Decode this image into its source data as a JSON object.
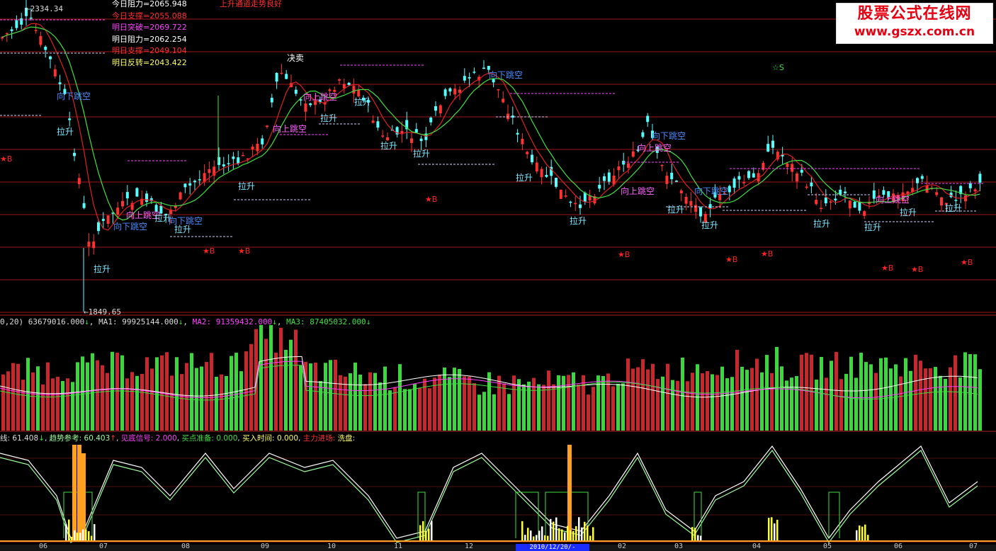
{
  "header": {
    "high_marker": "2334.34",
    "low_marker": "1849.65",
    "status_text": "上升通道走势良好",
    "levels": [
      {
        "label": "今日阻力=",
        "value": "2065.948",
        "color": "#ffffff"
      },
      {
        "label": "今日支撑=",
        "value": "2055.088",
        "color": "#ff3030"
      },
      {
        "label": "明日突破=",
        "value": "2069.722",
        "color": "#ff40ff"
      },
      {
        "label": "明日阻力=",
        "value": "2062.254",
        "color": "#ffffff"
      },
      {
        "label": "明日支撑=",
        "value": "2049.104",
        "color": "#ff3030"
      },
      {
        "label": "明日反转=",
        "value": "2043.422",
        "color": "#ffff60"
      }
    ]
  },
  "logo": {
    "line1": "股票公式在线网",
    "line2": "www.gszx.com.cn"
  },
  "signals": {
    "gap_down": "向下跳空",
    "gap_up": "向上跳空",
    "pull_up": "拉升",
    "buy_sell": "决卖",
    "star_b": "★B",
    "star_s": "☆S"
  },
  "volume_panel": {
    "prefix": "0,20)",
    "vol": "63679016.000",
    "ma1_label": "MA1:",
    "ma1": "99925144.000",
    "ma2_label": "MA2:",
    "ma2": "91359432.000",
    "ma3_label": "MA3:",
    "ma3": "87405032.000",
    "arrow": "↓"
  },
  "indicator_panel": {
    "line_label": "线:",
    "line_value": "61.408",
    "trend_label": "趋势参考:",
    "trend_value": "60.403",
    "up_arrow": "↑",
    "down_arrow": "↓",
    "bottom_label": "见底信号:",
    "bottom_value": "2.000",
    "prep_label": "买点准备:",
    "prep_value": "0.000",
    "buytime_label": "买入时间:",
    "buytime_value": "0.000",
    "main_label": "主力进场:",
    "wash_label": "洗盘:"
  },
  "time_axis": {
    "labels": [
      "06",
      "07",
      "08",
      "09",
      "10",
      "11",
      "12",
      "02",
      "03",
      "04",
      "05",
      "06",
      "07"
    ],
    "selected_date": "2010/12/20/-"
  },
  "colors": {
    "up": "#ff3232",
    "down": "#54ffff",
    "vol_up": "#c8282d",
    "vol_down": "#3ed63e",
    "ma_red": "#e02020",
    "ma_green": "#40e040",
    "dash_white": "#d0d0ff",
    "dash_magenta": "#ff40ff",
    "grid": "#a01818"
  }
}
